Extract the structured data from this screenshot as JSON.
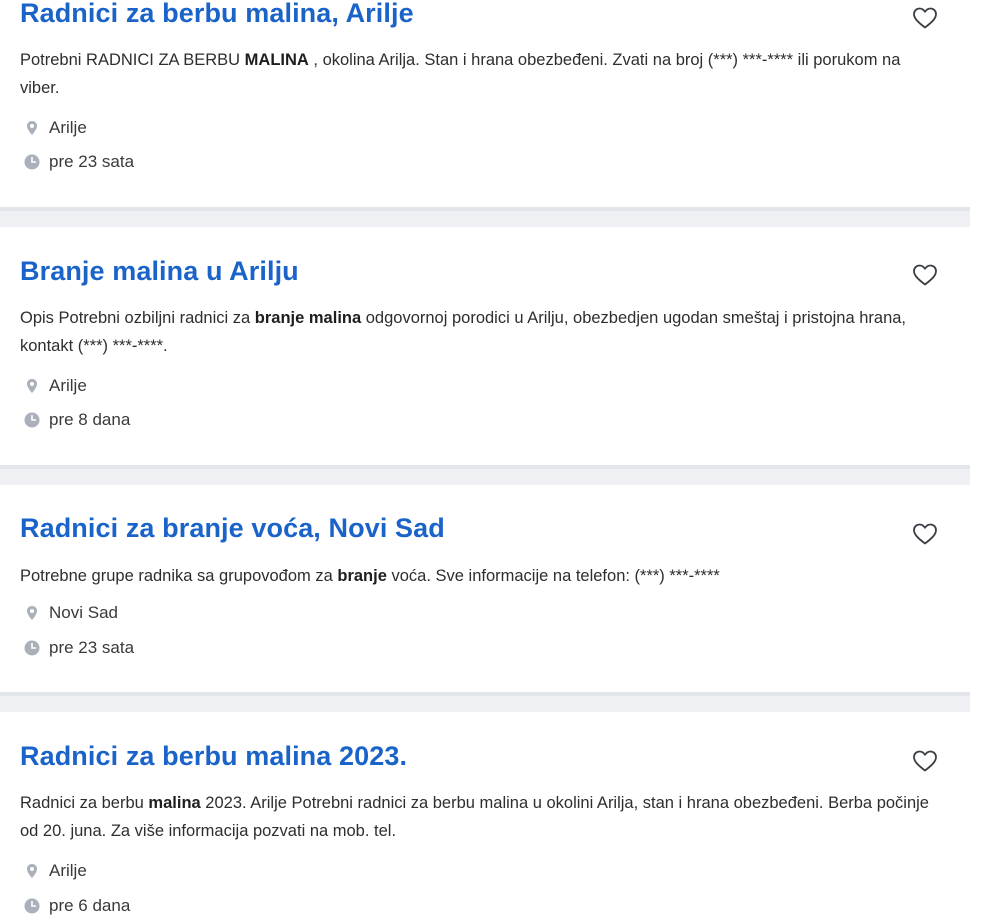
{
  "listings": [
    {
      "title": "Radnici za berbu malina, Arilje",
      "desc_parts": [
        "Potrebni RADNICI ZA BERBU ",
        "MALINA",
        " , okolina Arilja. Stan i hrana obezbeđeni. Zvati na broj (***) ***-**** ili porukom na viber."
      ],
      "location": "Arilje",
      "time": "pre 23 sata"
    },
    {
      "title": "Branje malina u Arilju",
      "desc_parts": [
        "Opis Potrebni ozbiljni radnici za ",
        "branje malina",
        " odgovornoj porodici u Arilju, obezbedjen ugodan smeštaj i pristojna hrana, kontakt (***) ***-****."
      ],
      "location": "Arilje",
      "time": "pre 8 dana"
    },
    {
      "title": "Radnici za branje voća, Novi Sad",
      "desc_parts": [
        "Potrebne grupe radnika sa grupovođom za ",
        "branje",
        " voća. Sve informacije na telefon: (***) ***-****"
      ],
      "location": "Novi Sad",
      "time": "pre 23 sata"
    },
    {
      "title": "Radnici za berbu malina 2023.",
      "desc_parts": [
        "Radnici za berbu ",
        "malina",
        " 2023. Arilje Potrebni radnici za berbu malina u okolini Arilja, stan i hrana obezbeđeni. Berba počinje od 20. juna. Za više informacija pozvati na mob. tel."
      ],
      "location": "Arilje",
      "time": "pre 6 dana"
    }
  ],
  "colors": {
    "title": "#1a63c9",
    "separator": "#eef0f3",
    "icon": "#a9b0b9"
  },
  "icons": {
    "favorite": "heart-outline-icon",
    "location": "location-pin-icon",
    "time": "clock-icon"
  }
}
